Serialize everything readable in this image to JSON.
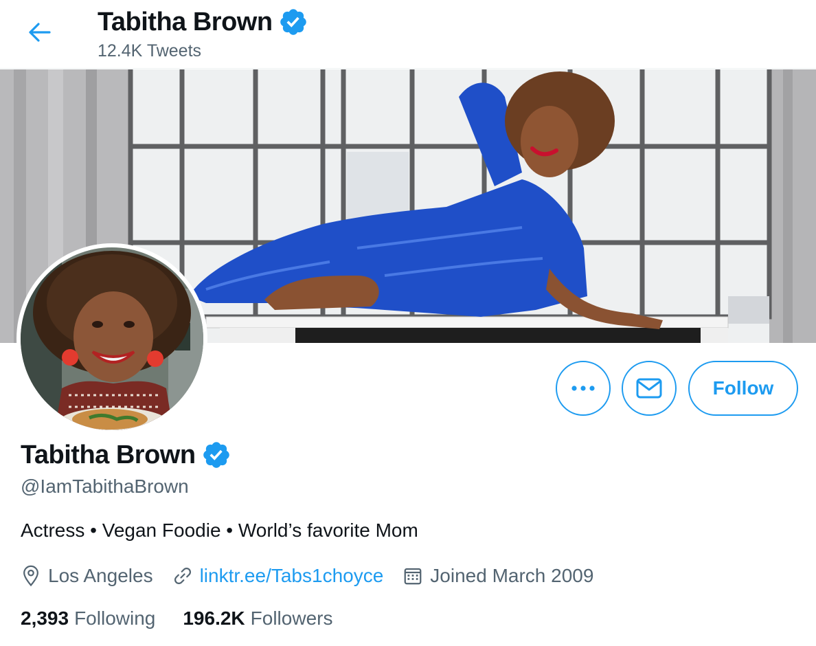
{
  "header": {
    "name": "Tabitha Brown",
    "tweet_count": "12.4K Tweets"
  },
  "profile": {
    "name": "Tabitha Brown",
    "handle": "@IamTabithaBrown",
    "bio": "Actress • Vegan Foodie • World’s favorite Mom",
    "location": "Los Angeles",
    "website": "linktr.ee/Tabs1choyce",
    "joined": "Joined March 2009",
    "verified": true
  },
  "actions": {
    "follow_label": "Follow"
  },
  "stats": {
    "following_count": "2,393",
    "following_label": "Following",
    "followers_count": "196.2K",
    "followers_label": "Followers"
  },
  "icons": {
    "back": "arrow-left-icon",
    "verified": "verified-badge-icon",
    "more": "more-dots-icon",
    "message": "envelope-icon",
    "location": "location-pin-icon",
    "link": "link-icon",
    "calendar": "calendar-icon"
  },
  "colors": {
    "accent": "#1d9bf0",
    "text_primary": "#0f1419",
    "text_secondary": "#536471"
  }
}
